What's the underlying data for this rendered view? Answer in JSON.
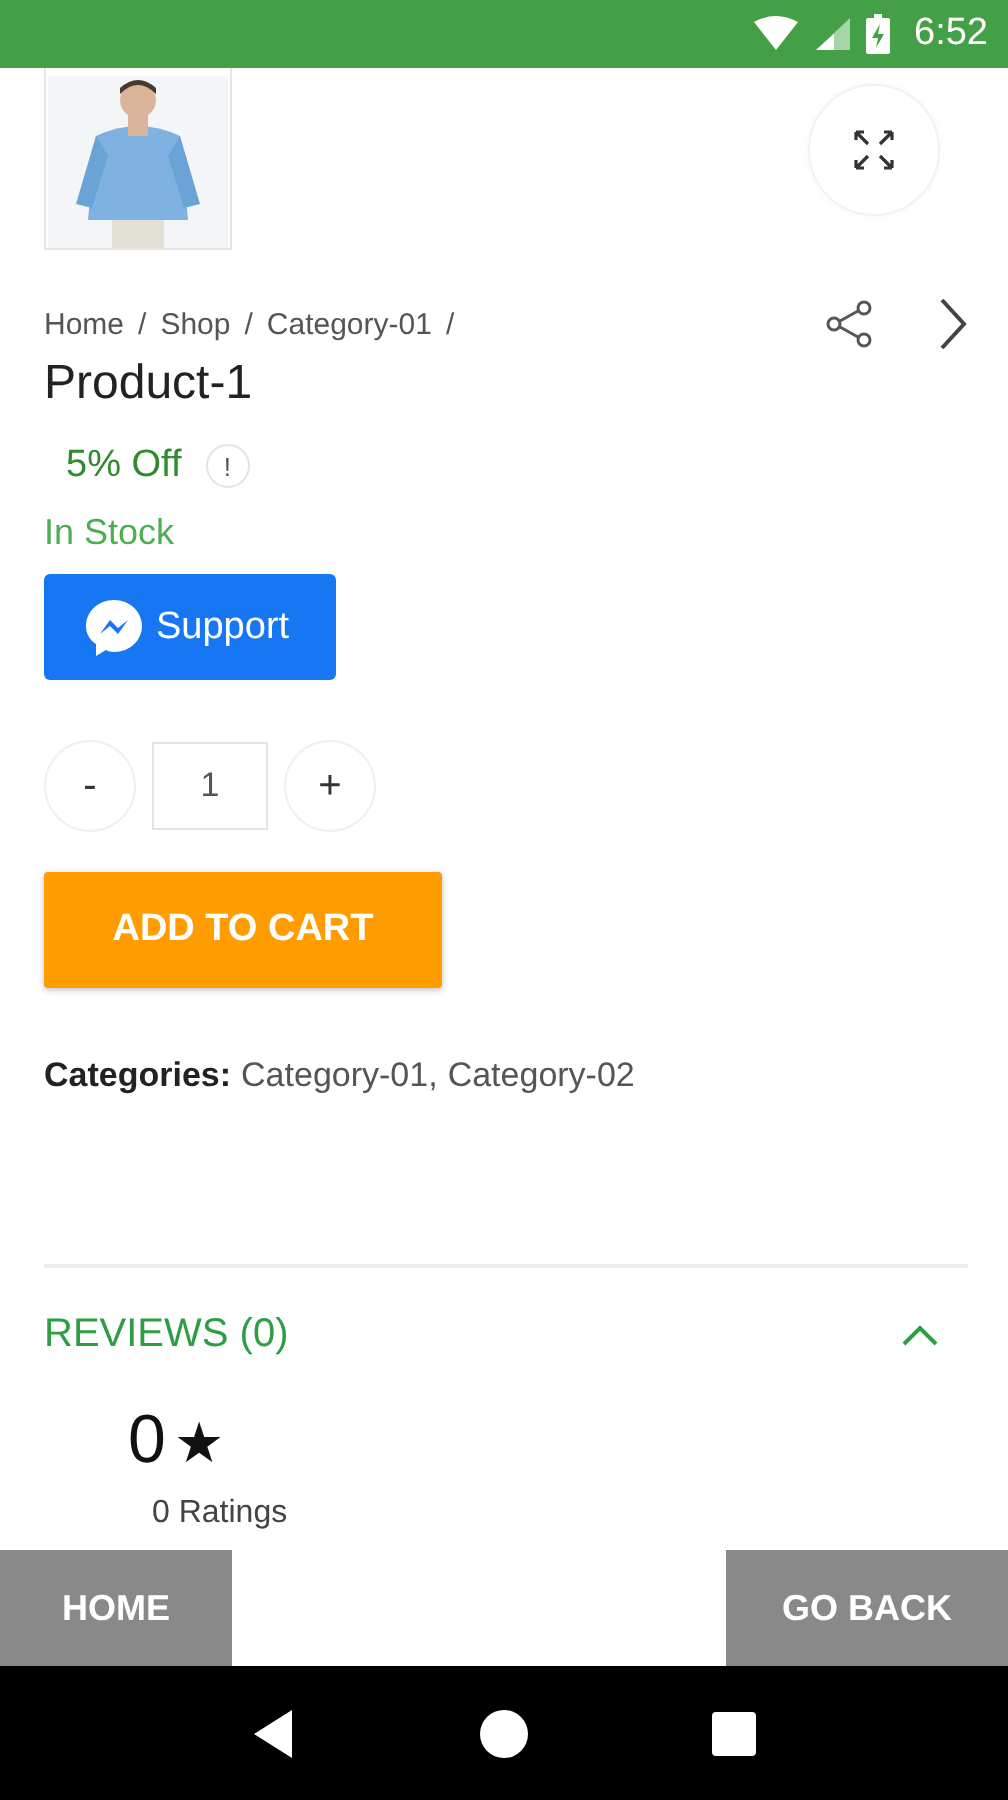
{
  "status_bar": {
    "time": "6:52"
  },
  "breadcrumb": [
    "Home",
    "Shop",
    "Category-01"
  ],
  "breadcrumb_separator": "/",
  "product": {
    "title": "Product-1",
    "discount": "5% Off",
    "info_icon": "!",
    "stock": "In Stock"
  },
  "support_button": {
    "label": "Support"
  },
  "quantity": {
    "minus": "-",
    "value": "1",
    "plus": "+"
  },
  "add_to_cart": {
    "label": "ADD TO CART"
  },
  "categories": {
    "label": "Categories:",
    "items": [
      "Category-01",
      "Category-02"
    ],
    "separator": ","
  },
  "reviews": {
    "title": "REVIEWS (0)",
    "expanded": true,
    "rating": "0",
    "star": "★",
    "ratings_count": "0 Ratings"
  },
  "bottom_buttons": [
    {
      "label": "HOME",
      "kind": "left"
    },
    {
      "label": "GO BACK",
      "kind": "right"
    }
  ]
}
